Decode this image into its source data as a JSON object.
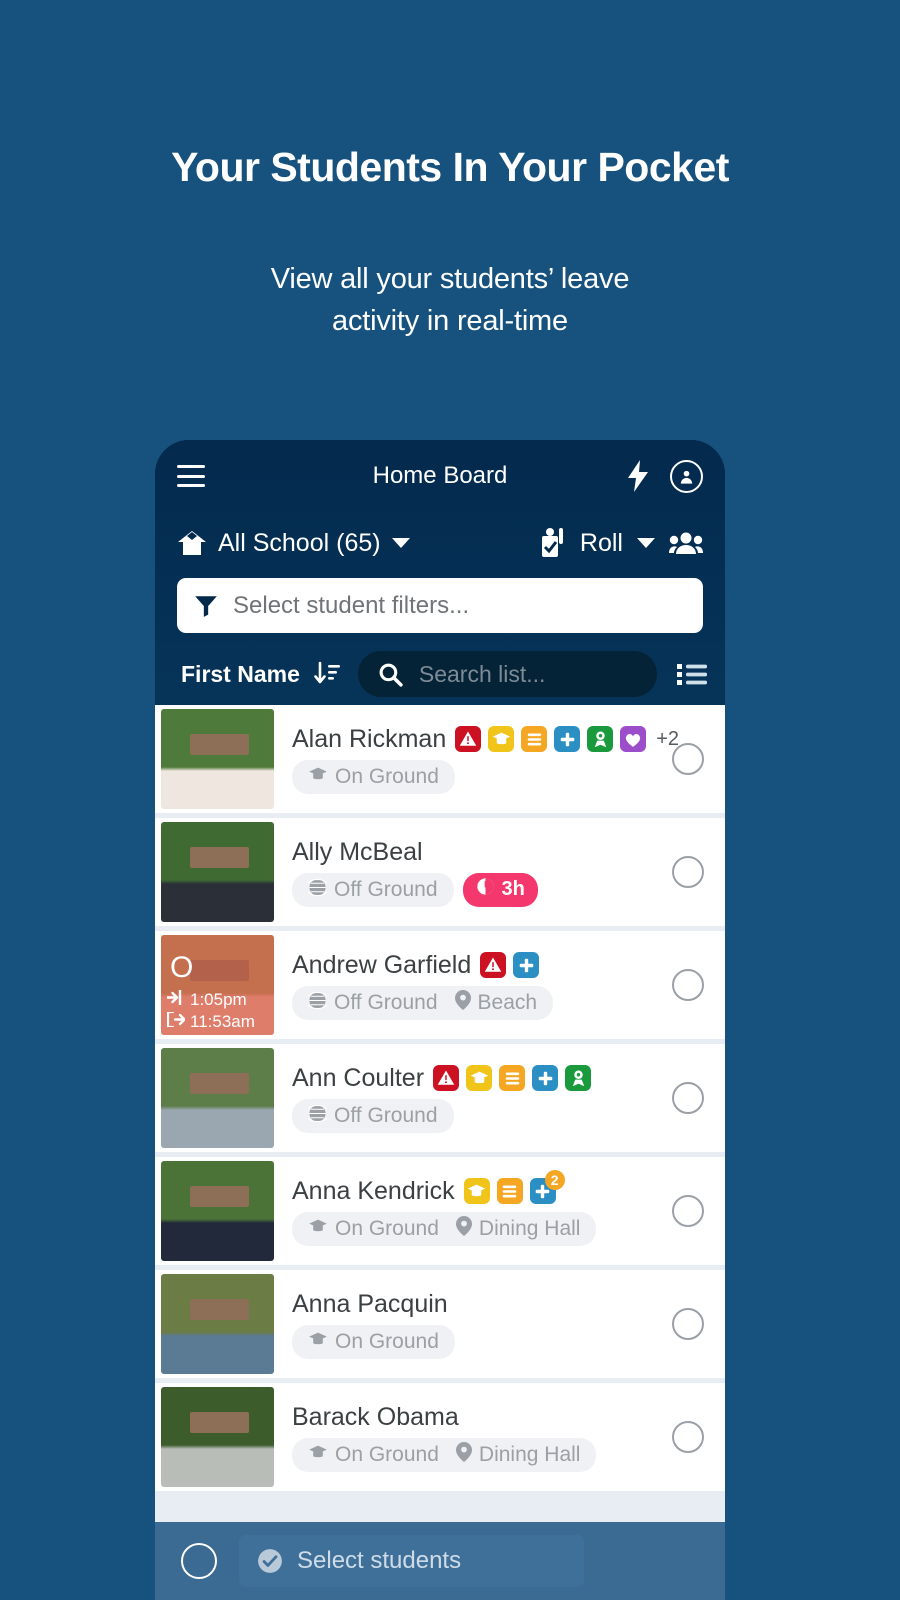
{
  "promo": {
    "title": "Your Students In Your Pocket",
    "subtitle_line1": "View all your students’ leave",
    "subtitle_line2": "activity in real-time"
  },
  "colors": {
    "page_background": "#17527e",
    "phone_header": "#042a4d",
    "list_background": "#e8ecf3",
    "bottom_bar": "#3b6a93",
    "time_badge_pink": "#f4376d",
    "badge_red": "#cc1122",
    "badge_yellow": "#f0c419",
    "badge_orange": "#f5a623",
    "badge_blue": "#2b8fc4",
    "badge_green": "#1a9a3c",
    "badge_purple": "#9b4dca"
  },
  "appbar": {
    "menu_icon": "hamburger-menu-icon",
    "title": "Home Board",
    "bolt_icon": "lightning-bolt-icon",
    "account_icon": "account-avatar-icon"
  },
  "schoolbar": {
    "home_icon": "home-icon",
    "school_label": "All School (65)",
    "school_caret": "chevron-down-icon",
    "roll_icon": "roll-check-icon",
    "roll_label": "Roll",
    "roll_caret": "chevron-down-icon",
    "groups_icon": "people-group-icon"
  },
  "filter": {
    "icon": "funnel-filter-icon",
    "placeholder": "Select student filters..."
  },
  "sortbar": {
    "sort_label": "First Name",
    "sort_icon": "sort-descending-icon",
    "search_icon": "search-icon",
    "search_placeholder": "Search list...",
    "listview_icon": "list-view-icon"
  },
  "students": [
    {
      "name": "Alan Rickman",
      "badges": [
        "alert",
        "graduation",
        "notes",
        "medical",
        "award",
        "heart"
      ],
      "overflow": "+2",
      "status_icon": "graduation-cap-icon",
      "status": "On Ground",
      "location": null,
      "location_icon": null,
      "time_badge": null,
      "avatar": {
        "bg": "#4e7a3c",
        "shirt": "#efe7df",
        "overlay": false
      }
    },
    {
      "name": "Ally McBeal",
      "badges": [],
      "overflow": null,
      "status_icon": "globe-icon",
      "status": "Off Ground",
      "location": null,
      "location_icon": null,
      "time_badge": {
        "icon": "clock-icon",
        "label": "3h"
      },
      "avatar": {
        "bg": "#3f6b33",
        "shirt": "#2a2f38",
        "overlay": false
      }
    },
    {
      "name": "Andrew Garfield",
      "badges": [
        "alert",
        "medical"
      ],
      "overflow": null,
      "status_icon": "globe-icon",
      "status": "Off Ground",
      "location": "Beach",
      "location_icon": "map-pin-icon",
      "time_badge": null,
      "avatar": {
        "bg": "#b08a5c",
        "shirt": "#e8a79a",
        "overlay": true,
        "letter": "O",
        "sign_in_icon": "sign-in-arrow-icon",
        "sign_in_time": "1:05pm",
        "sign_out_icon": "sign-out-arrow-icon",
        "sign_out_time": "11:53am"
      }
    },
    {
      "name": "Ann Coulter",
      "badges": [
        "alert",
        "graduation",
        "notes",
        "medical",
        "award"
      ],
      "overflow": null,
      "status_icon": "globe-icon",
      "status": "Off Ground",
      "location": null,
      "location_icon": null,
      "time_badge": null,
      "avatar": {
        "bg": "#5d7d49",
        "shirt": "#9aa7b0",
        "overlay": false
      }
    },
    {
      "name": "Anna Kendrick",
      "badges": [
        "graduation",
        "notes",
        "medical"
      ],
      "badge_count_on_last": "2",
      "overflow": null,
      "status_icon": "graduation-cap-icon",
      "status": "On Ground",
      "location": "Dining Hall",
      "location_icon": "map-pin-icon",
      "time_badge": null,
      "avatar": {
        "bg": "#4b7337",
        "shirt": "#22293a",
        "overlay": false
      }
    },
    {
      "name": "Anna Pacquin",
      "badges": [],
      "overflow": null,
      "status_icon": "graduation-cap-icon",
      "status": "On Ground",
      "location": null,
      "location_icon": null,
      "time_badge": null,
      "avatar": {
        "bg": "#6b7c45",
        "shirt": "#5b7a94",
        "overlay": false
      }
    },
    {
      "name": "Barack Obama",
      "badges": [],
      "overflow": null,
      "status_icon": "graduation-cap-icon",
      "status": "On Ground",
      "location": "Dining Hall",
      "location_icon": "map-pin-icon",
      "time_badge": null,
      "avatar": {
        "bg": "#3d5c2c",
        "shirt": "#b9bdb7",
        "overlay": false
      }
    }
  ],
  "bottombar": {
    "circle_icon": "select-all-circle-icon",
    "check_icon": "check-circle-icon",
    "label": "Select students"
  }
}
